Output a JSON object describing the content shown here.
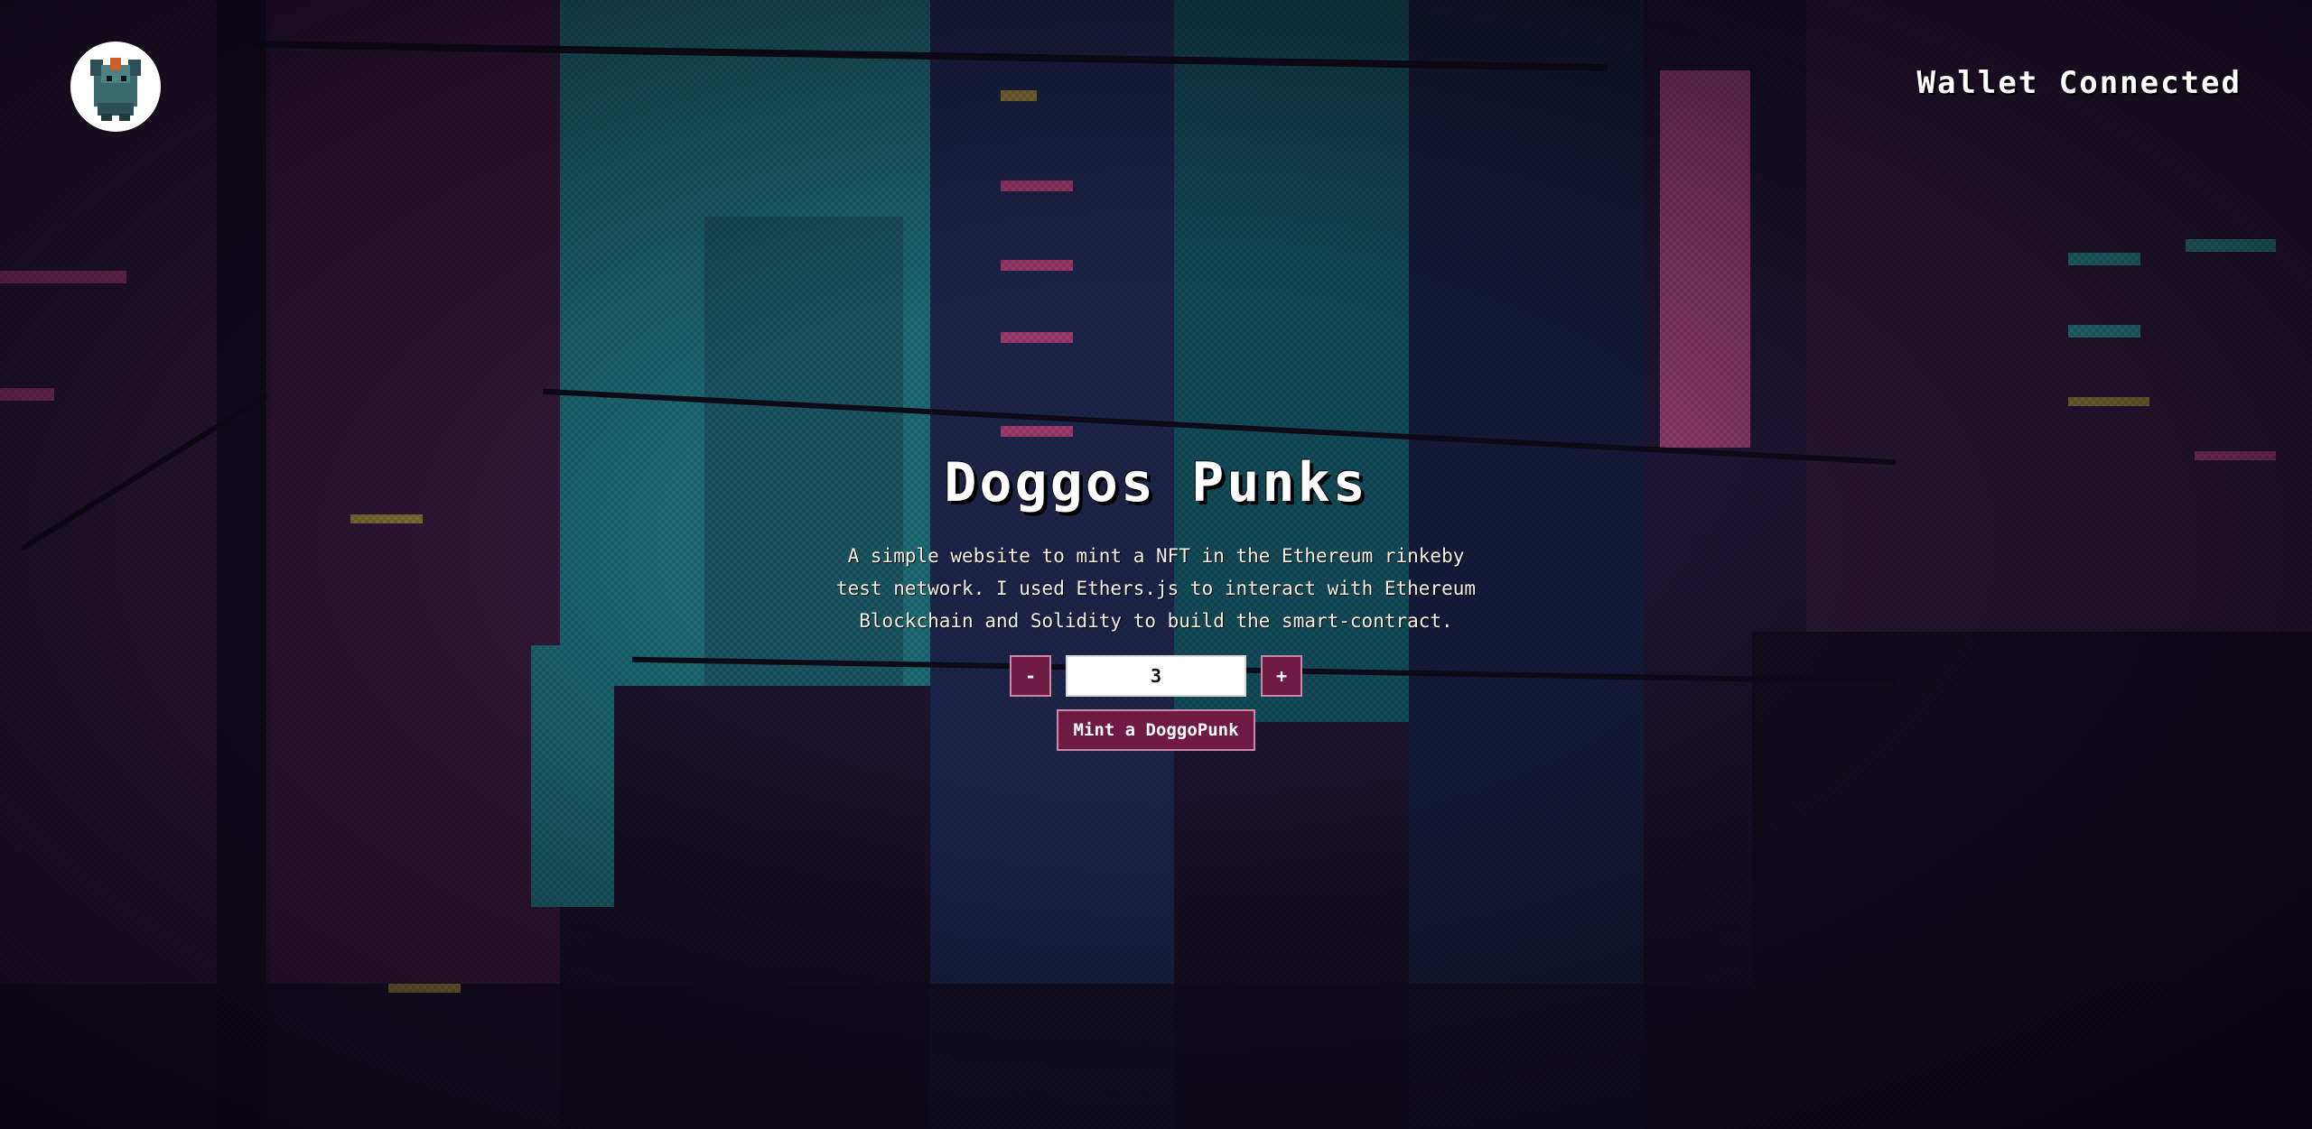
{
  "header": {
    "logo_icon": "doggo-logo-icon",
    "wallet_status": "Wallet Connected"
  },
  "hero": {
    "title": "Doggos Punks",
    "description": "A simple website to mint a NFT in the Ethereum rinkeby test network. I used Ethers.js to interact with Ethereum Blockchain and Solidity to build the smart-contract."
  },
  "mint": {
    "decrement_label": "-",
    "quantity": "3",
    "increment_label": "+",
    "mint_label": "Mint a DoggoPunk"
  },
  "colors": {
    "button_bg": "#6e1a43",
    "button_border": "#c98aa8",
    "teal": "#1d6a73",
    "pink_sign": "#8a3a6a"
  }
}
